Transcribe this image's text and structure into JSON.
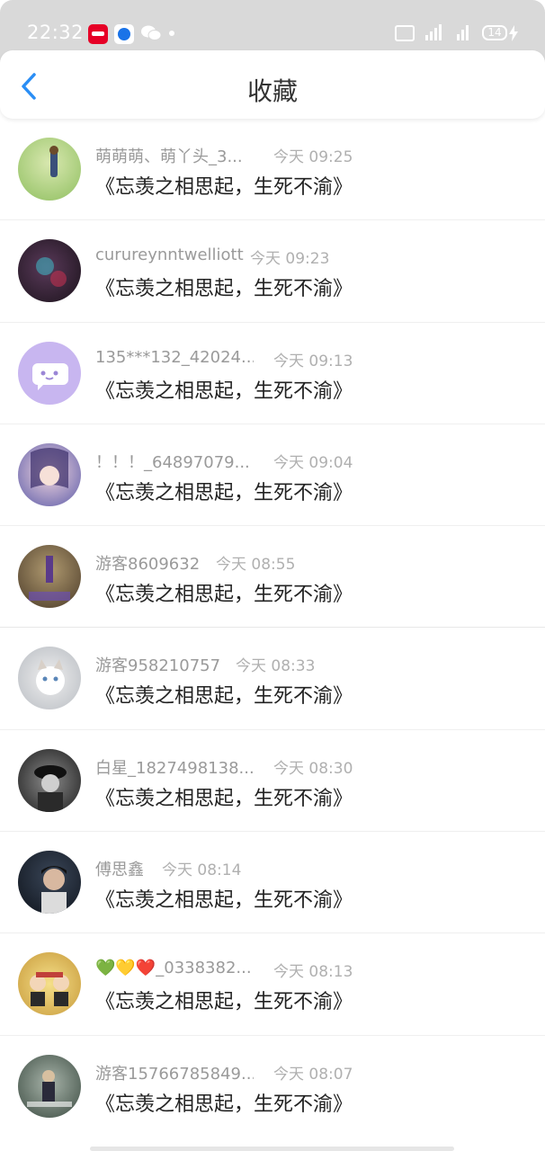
{
  "status_bar": {
    "time": "22:32",
    "battery": "14",
    "icons": [
      "red-app-icon",
      "blue-app-icon",
      "wechat-icon",
      "hd-icon",
      "signal-4g-icon",
      "signal-icon",
      "battery-icon",
      "charging-icon"
    ]
  },
  "header": {
    "title": "收藏",
    "back_icon": "chevron-left-icon",
    "accent": "#2a8ef5"
  },
  "items": [
    {
      "name": "萌萌萌、萌丫头_3...",
      "time": "今天 09:25",
      "content": "《忘羡之相思起，生死不渝》",
      "avatar_color": "#a8d08d"
    },
    {
      "name": "curureynntwelliott",
      "time": "今天 09:23",
      "content": "《忘羡之相思起，生死不渝》",
      "avatar_color": "#2b1f2c"
    },
    {
      "name": "135***132_42024...",
      "time": "今天 09:13",
      "content": "《忘羡之相思起，生死不渝》",
      "avatar_color": "#c8b6f0"
    },
    {
      "name": "！！！_64897079...",
      "time": "今天 09:04",
      "content": "《忘羡之相思起，生死不渝》",
      "avatar_color": "#6b6db5"
    },
    {
      "name": "游客8609632",
      "time": "今天 08:55",
      "content": "《忘羡之相思起，生死不渝》",
      "avatar_color": "#7a6648"
    },
    {
      "name": "游客958210757",
      "time": "今天 08:33",
      "content": "《忘羡之相思起，生死不渝》",
      "avatar_color": "#cfd2d6"
    },
    {
      "name": "白星_1827498138...",
      "time": "今天 08:30",
      "content": "《忘羡之相思起，生死不渝》",
      "avatar_color": "#3a3a3a"
    },
    {
      "name": "傅思鑫",
      "time": "今天 08:14",
      "content": "《忘羡之相思起，生死不渝》",
      "avatar_color": "#1d2430"
    },
    {
      "name": "💚💛❤️_0338382...",
      "time": "今天 08:13",
      "content": "《忘羡之相思起，生死不渝》",
      "avatar_color": "#e8c25a"
    },
    {
      "name": "游客15766785849...",
      "time": "今天 08:07",
      "content": "《忘羡之相思起，生死不渝》",
      "avatar_color": "#5a6a60"
    }
  ]
}
